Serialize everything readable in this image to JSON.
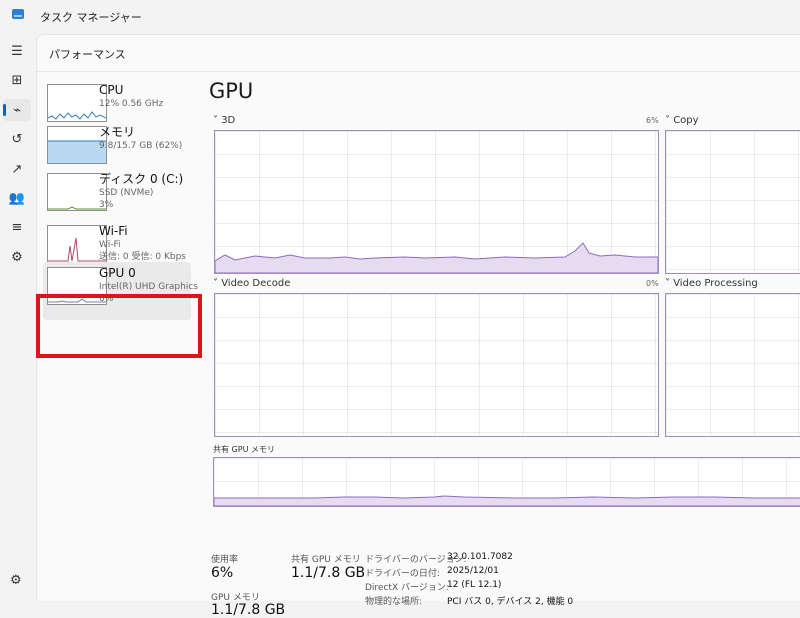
{
  "window": {
    "title": "タスク マネージャー"
  },
  "nav": {
    "items": [
      {
        "icon": "hamburger-icon"
      },
      {
        "icon": "processes-icon"
      },
      {
        "icon": "performance-icon",
        "active": true
      },
      {
        "icon": "history-icon"
      },
      {
        "icon": "startup-icon"
      },
      {
        "icon": "users-icon"
      },
      {
        "icon": "details-icon"
      },
      {
        "icon": "services-icon"
      }
    ],
    "settings_icon": "gear-icon"
  },
  "page": {
    "title": "パフォーマンス"
  },
  "devices": [
    {
      "name": "CPU",
      "sub1": "12%  0.56 GHz",
      "sub2": "",
      "sub3": ""
    },
    {
      "name": "メモリ",
      "sub1": "9.8/15.7 GB (62%)",
      "sub2": "",
      "sub3": ""
    },
    {
      "name": "ディスク 0 (C:)",
      "sub1": "SSD (NVMe)",
      "sub2": "3%",
      "sub3": ""
    },
    {
      "name": "Wi-Fi",
      "sub1": "Wi-Fi",
      "sub2": "送信: 0  受信: 0 Kbps",
      "sub3": ""
    },
    {
      "name": "GPU 0",
      "sub1": "Intel(R) UHD Graphics",
      "sub2": "6%",
      "sub3": "",
      "selected": true
    }
  ],
  "gpu": {
    "title": "GPU",
    "engines": [
      {
        "label": "3D",
        "pct": "6%"
      },
      {
        "label": "Copy",
        "pct": ""
      },
      {
        "label": "Video Decode",
        "pct": "0%"
      },
      {
        "label": "Video Processing",
        "pct": ""
      }
    ],
    "shared_mem_label": "共有 GPU メモリ"
  },
  "stats": {
    "utilization_label": "使用率",
    "utilization_value": "6%",
    "shared_label": "共有 GPU メモリ",
    "shared_value": "1.1/7.8 GB",
    "gpu_mem_label": "GPU メモリ",
    "gpu_mem_value": "1.1/7.8 GB"
  },
  "info": [
    {
      "k": "ドライバーのバージョン:",
      "v": "32.0.101.7082"
    },
    {
      "k": "ドライバーの日付:",
      "v": "2025/12/01"
    },
    {
      "k": "DirectX バージョン:",
      "v": "12 (FL 12.1)"
    },
    {
      "k": "物理的な場所:",
      "v": "PCI バス 0, デバイス 2, 機能 0"
    }
  ],
  "colors": {
    "accent": "#0067c0",
    "graph_line": "#8c6bbf",
    "graph_fill": "#e6dcf2",
    "highlight": "#d9161b"
  }
}
